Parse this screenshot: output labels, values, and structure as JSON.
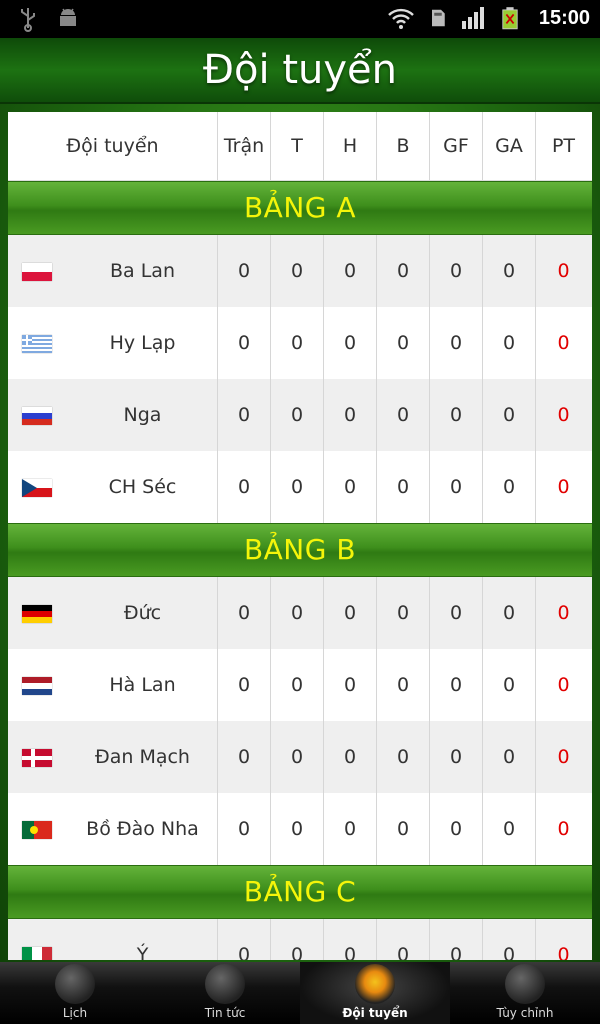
{
  "status": {
    "time": "15:00",
    "icons": [
      "usb-icon",
      "android-debug-icon",
      "wifi-icon",
      "sd-card-icon",
      "signal-icon",
      "battery-icon"
    ]
  },
  "title": "Đội tuyển",
  "table": {
    "headers": [
      "Đội tuyển",
      "Trận",
      "T",
      "H",
      "B",
      "GF",
      "GA",
      "PT"
    ],
    "groups": [
      {
        "name": "BẢNG A",
        "teams": [
          {
            "name": "Ba Lan",
            "flag": "poland",
            "stats": [
              "0",
              "0",
              "0",
              "0",
              "0",
              "0"
            ],
            "pt": "0"
          },
          {
            "name": "Hy Lạp",
            "flag": "greece",
            "stats": [
              "0",
              "0",
              "0",
              "0",
              "0",
              "0"
            ],
            "pt": "0"
          },
          {
            "name": "Nga",
            "flag": "russia",
            "stats": [
              "0",
              "0",
              "0",
              "0",
              "0",
              "0"
            ],
            "pt": "0"
          },
          {
            "name": "CH Séc",
            "flag": "czech",
            "stats": [
              "0",
              "0",
              "0",
              "0",
              "0",
              "0"
            ],
            "pt": "0"
          }
        ]
      },
      {
        "name": "BẢNG B",
        "teams": [
          {
            "name": "Đức",
            "flag": "germany",
            "stats": [
              "0",
              "0",
              "0",
              "0",
              "0",
              "0"
            ],
            "pt": "0"
          },
          {
            "name": "Hà Lan",
            "flag": "netherlands",
            "stats": [
              "0",
              "0",
              "0",
              "0",
              "0",
              "0"
            ],
            "pt": "0"
          },
          {
            "name": "Đan Mạch",
            "flag": "denmark",
            "stats": [
              "0",
              "0",
              "0",
              "0",
              "0",
              "0"
            ],
            "pt": "0"
          },
          {
            "name": "Bồ Đào Nha",
            "flag": "portugal",
            "stats": [
              "0",
              "0",
              "0",
              "0",
              "0",
              "0"
            ],
            "pt": "0"
          }
        ]
      },
      {
        "name": "BẢNG C",
        "teams": [
          {
            "name": "Ý",
            "flag": "italy",
            "stats": [
              "0",
              "0",
              "0",
              "0",
              "0",
              "0"
            ],
            "pt": "0"
          }
        ]
      }
    ]
  },
  "tabs": [
    {
      "label": "Lịch",
      "icon": "soccer-ball-icon",
      "active": false
    },
    {
      "label": "Tin tức",
      "icon": "news-icon",
      "active": false
    },
    {
      "label": "Đội tuyển",
      "icon": "jersey-icon",
      "active": true
    },
    {
      "label": "Tùy chỉnh",
      "icon": "gear-icon",
      "active": false
    }
  ],
  "colors": {
    "accent_group": "#f5f50a",
    "points": "#e10000",
    "header_green": "#1d7212"
  }
}
